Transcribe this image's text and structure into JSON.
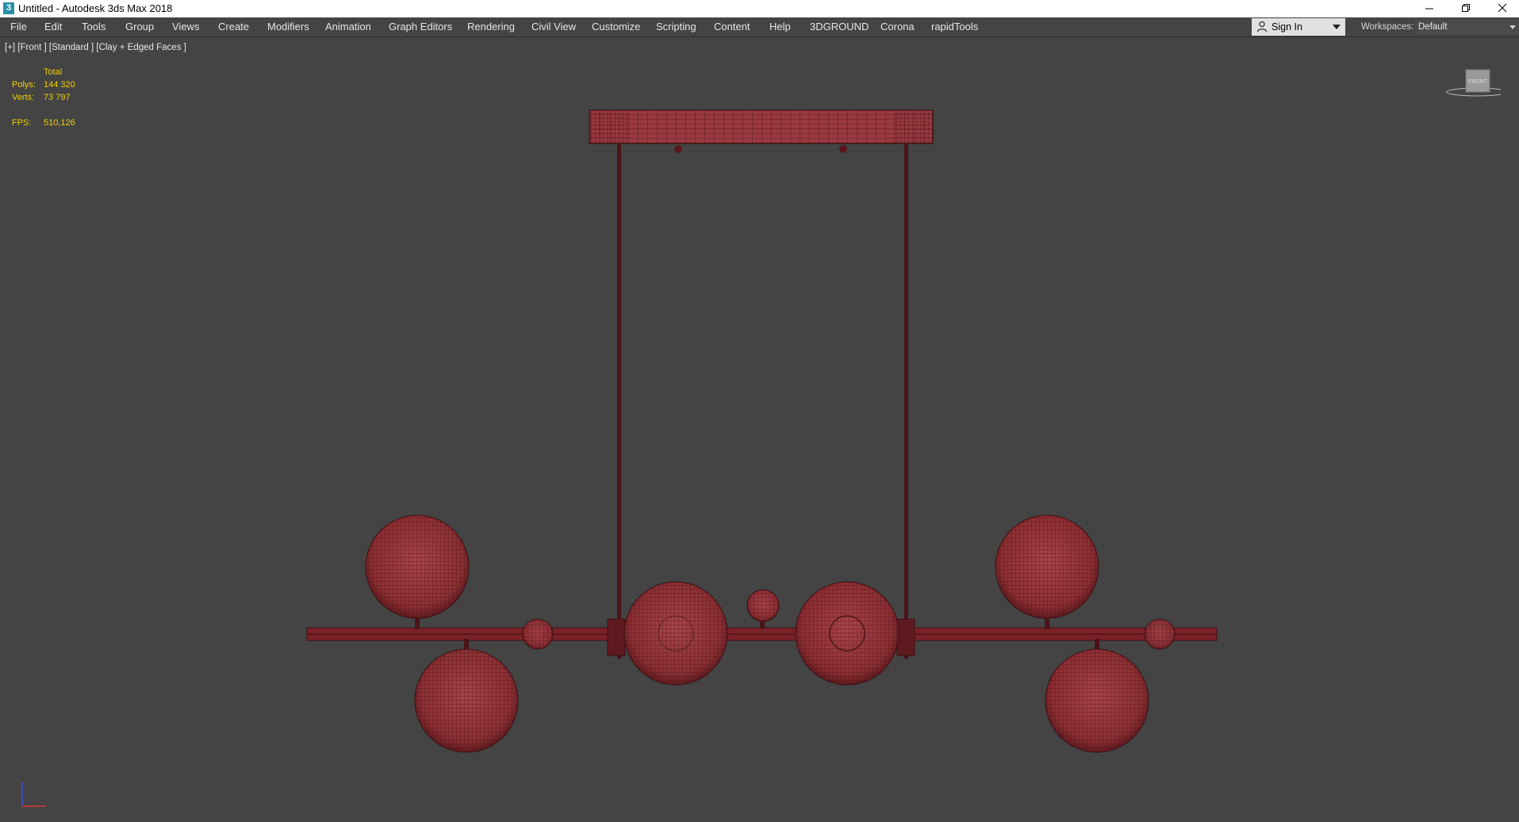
{
  "window": {
    "title": "Untitled - Autodesk 3ds Max 2018",
    "icon_name": "app-3dsmax-icon",
    "controls": [
      "minimize-icon",
      "restore-icon",
      "close-icon"
    ]
  },
  "menu": {
    "items": [
      "File",
      "Edit",
      "Tools",
      "Group",
      "Views",
      "Create",
      "Modifiers",
      "Animation",
      "Graph Editors",
      "Rendering",
      "Civil View",
      "Customize",
      "Scripting",
      "Content",
      "Help",
      "3DGROUND",
      "Corona",
      "rapidTools"
    ]
  },
  "signin": {
    "label": "Sign In",
    "icon_name": "user-icon"
  },
  "workspaces": {
    "label": "Workspaces:",
    "value": "Default"
  },
  "viewport": {
    "label": "[+] [Front ] [Standard ] [Clay + Edged Faces ]",
    "stats": {
      "total_label": "Total",
      "polys_label": "Polys:",
      "polys_value": "144 320",
      "verts_label": "Verts:",
      "verts_value": "73 797",
      "fps_label": "FPS:",
      "fps_value": "510,126"
    },
    "viewcube_label": "FRONT"
  },
  "colors": {
    "viewport_bg": "#444444",
    "stats_text": "#f0d000",
    "model_fill": "#8c2f33",
    "model_wire": "#3a0f12",
    "rod": "#4a1418"
  }
}
